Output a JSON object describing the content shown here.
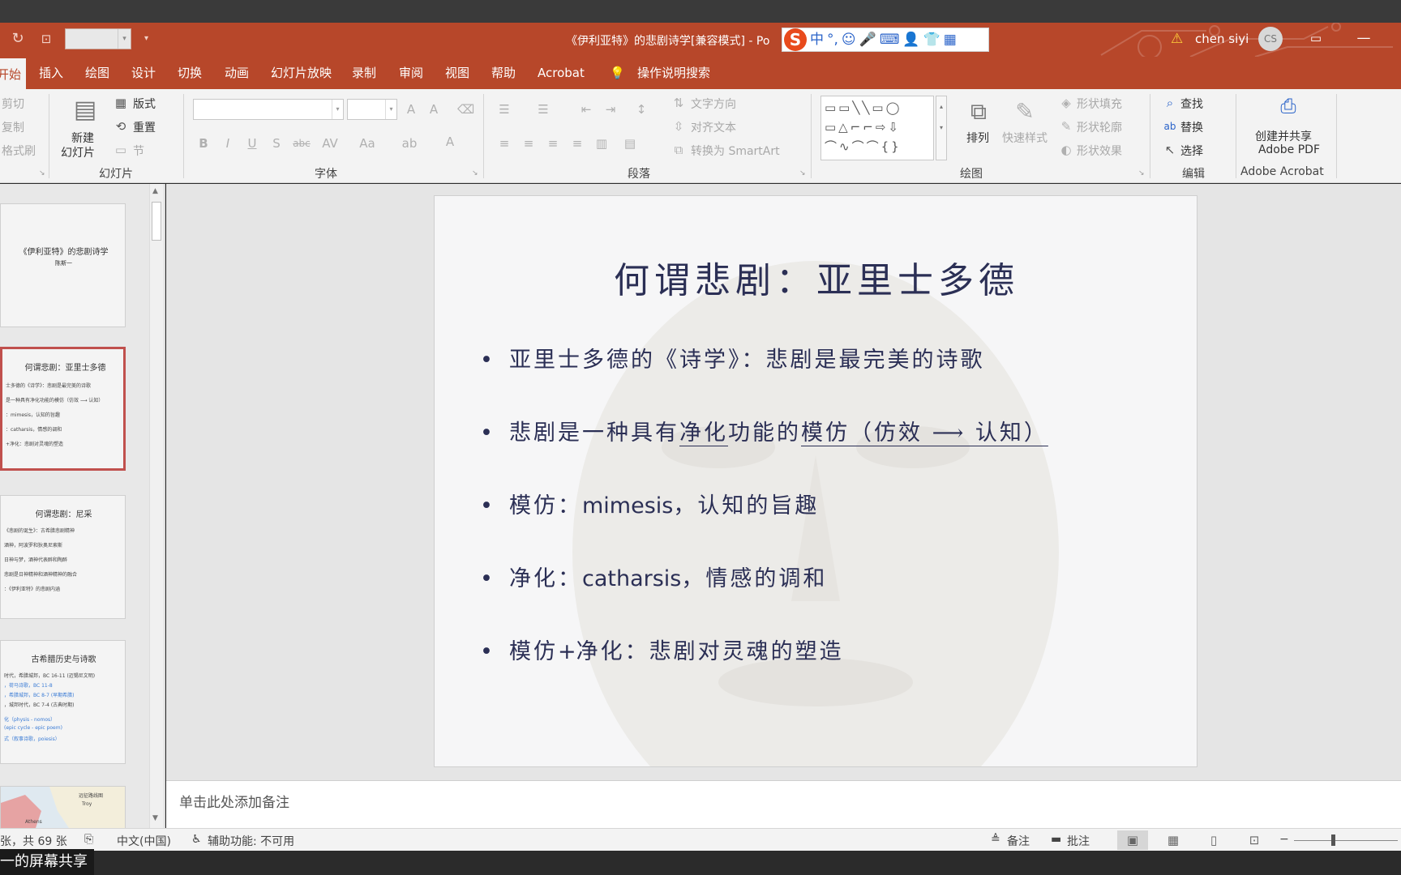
{
  "titlebar": {
    "doc_title": "《伊利亚特》的悲剧诗学[兼容模式] - Po",
    "ime_logo": "S",
    "ime_items": [
      "中",
      "°,",
      "☺",
      "🎤",
      "⌨",
      "👤",
      "👕",
      "▦"
    ],
    "user_name": "chen siyi",
    "user_initials": "CS"
  },
  "tabs": [
    "开始",
    "插入",
    "绘图",
    "设计",
    "切换",
    "动画",
    "幻灯片放映",
    "录制",
    "审阅",
    "视图",
    "帮助",
    "Acrobat"
  ],
  "tell_me": "操作说明搜索",
  "ribbon": {
    "clipboard": {
      "cut": "剪切",
      "copy": "复制",
      "format_painter": "格式刷"
    },
    "slides": {
      "new_slide": "新建",
      "new_slide_2": "幻灯片",
      "layout": "版式",
      "reset": "重置",
      "section": "节",
      "group_label": "幻灯片"
    },
    "font": {
      "group_label": "字体",
      "bold": "B",
      "italic": "I",
      "underline": "U",
      "shadow": "S",
      "strike": "abc",
      "spacing": "AV",
      "case": "Aa"
    },
    "paragraph": {
      "text_direction": "文字方向",
      "align_text": "对齐文本",
      "smartart": "转换为 SmartArt",
      "group_label": "段落"
    },
    "drawing": {
      "arrange": "排列",
      "quick_styles": "快速样式",
      "fill": "形状填充",
      "outline": "形状轮廓",
      "effects": "形状效果",
      "group_label": "绘图"
    },
    "editing": {
      "find": "查找",
      "replace": "替换",
      "select": "选择",
      "group_label": "编辑"
    },
    "acrobat": {
      "create_share": "创建并共享",
      "adobe_pdf": "Adobe PDF",
      "group_label": "Adobe Acrobat"
    }
  },
  "thumbnails": [
    {
      "title": "《伊利亚特》的悲剧诗学",
      "subtitle": "陈斯一",
      "lines": []
    },
    {
      "title": "何谓悲剧：亚里士多德",
      "subtitle": "",
      "lines": [
        "士多德的《诗学》：悲剧是最完美的诗歌",
        "是一种具有净化功能的模仿（仿效 ⟶ 认知）",
        "：mimesis，认知的旨趣",
        "：catharsis，情感的调和",
        "+净化：悲剧对灵魂的塑造"
      ]
    },
    {
      "title": "何谓悲剧：尼采",
      "subtitle": "",
      "lines": [
        "《悲剧的诞生》：古希腊悲剧精神",
        "酒神，阿波罗和狄奥尼索斯",
        "日神与梦，酒神代表醉和陶醉",
        "悲剧是日神精神和酒神精神的融合",
        "：《伊利亚特》的悲剧内涵"
      ]
    },
    {
      "title": "古希腊历史与诗歌",
      "subtitle": "",
      "lines": [
        "时代，希腊城邦，BC 16-11 (迈锡尼文明)",
        "，荷马诗歌，BC 11-8",
        "，希腊城邦，BC 8-7 (早期希腊)",
        "，城邦时代，BC 7-4 (古典时期)",
        "化（physis - nomos）",
        "(epic cycle - epic poem)",
        "式（叙事诗歌，poiesis）"
      ]
    },
    {
      "title": "远征路线图",
      "subtitle": "",
      "lines": [
        "Troy",
        "Athens"
      ]
    }
  ],
  "slide": {
    "title": "何谓悲剧：亚里士多德",
    "bullet_char": "•",
    "bullets": [
      {
        "text": "亚里士多德的《诗学》：悲剧是最完美的诗歌"
      },
      {
        "before": "悲剧是一种具有",
        "u1": "净化",
        "mid": "功能的",
        "u2": "模仿（仿效 ⟶ 认知）"
      },
      {
        "a": "模仿：",
        "latin": "mimesis",
        "b": "，认知的旨趣"
      },
      {
        "a": "净化：",
        "latin": "catharsis",
        "b": "，情感的调和"
      },
      {
        "a": "模仿",
        "latin": "+",
        "b": "净化：悲剧对灵魂的塑造"
      }
    ]
  },
  "notes_placeholder": "单击此处添加备注",
  "statusbar": {
    "slide_count": "张，共 69 张",
    "language": "中文(中国)",
    "accessibility": "辅助功能: 不可用",
    "notes": "备注",
    "comments": "批注"
  },
  "screen_share": "一的屏幕共享",
  "colors": {
    "accent": "#b7472a",
    "slide_text": "#2b2f55",
    "selected_thumb": "#c0504d"
  }
}
